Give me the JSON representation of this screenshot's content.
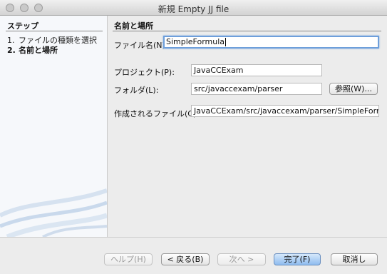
{
  "window": {
    "title": "新規 Empty JJ file"
  },
  "steps": {
    "heading": "ステップ",
    "items": [
      {
        "num": "1.",
        "label": "ファイルの種類を選択"
      },
      {
        "num": "2.",
        "label": "名前と場所"
      }
    ]
  },
  "form": {
    "section_title": "名前と場所",
    "file_name_label": "ファイル名(N):",
    "file_name_value": "SimpleFormula",
    "project_label": "プロジェクト(P):",
    "project_value": "JavaCCExam",
    "folder_label": "フォルダ(L):",
    "folder_value": "src/javaccexam/parser",
    "browse_label": "参照(W)...",
    "created_file_label": "作成されるファイル(C):",
    "created_file_value": "JavaCCExam/src/javaccexam/parser/SimpleFormula.jj"
  },
  "buttons": {
    "help": "ヘルプ(H)",
    "back": "< 戻る(B)",
    "next": "次へ >",
    "finish": "完了(F)",
    "cancel": "取消し"
  }
}
